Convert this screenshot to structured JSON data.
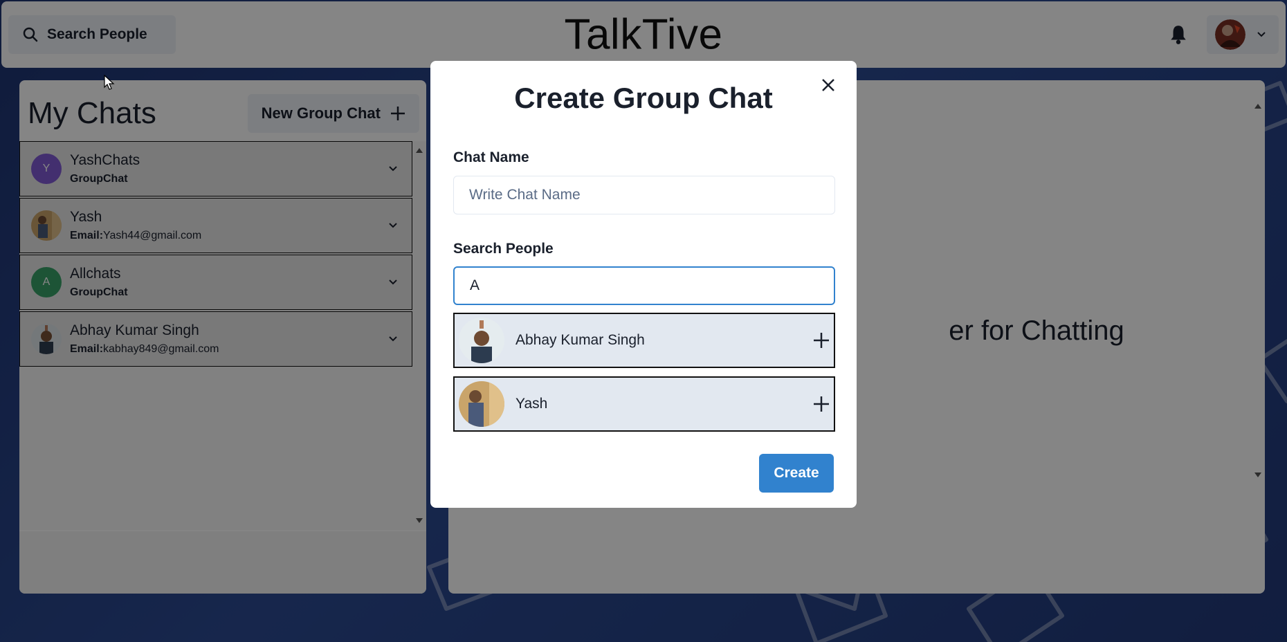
{
  "header": {
    "search_label": "Search People",
    "app_title": "TalkTive"
  },
  "chats": {
    "title": "My Chats",
    "new_group_label": "New Group Chat",
    "items": [
      {
        "name": "YashChats",
        "sub_label": "",
        "sub_value": "GroupChat",
        "avatar_letter": "Y",
        "avatar_color": "#805ad5"
      },
      {
        "name": "Yash",
        "sub_label": "Email:",
        "sub_value": "Yash44@gmail.com",
        "avatar_letter": "",
        "avatar_color": "#c9a46a"
      },
      {
        "name": "Allchats",
        "sub_label": "",
        "sub_value": "GroupChat",
        "avatar_letter": "A",
        "avatar_color": "#38a169"
      },
      {
        "name": "Abhay Kumar Singh",
        "sub_label": "Email:",
        "sub_value": "kabhay849@gmail.com",
        "avatar_letter": "",
        "avatar_color": "#dfe6ea"
      }
    ]
  },
  "chat_area": {
    "placeholder_visible": "er for Chatting"
  },
  "modal": {
    "title": "Create Group Chat",
    "chat_name_label": "Chat Name",
    "chat_name_placeholder": "Write Chat Name",
    "chat_name_value": "",
    "search_label": "Search People",
    "search_value": "A",
    "results": [
      {
        "name": "Abhay Kumar Singh"
      },
      {
        "name": "Yash"
      }
    ],
    "create_label": "Create"
  },
  "colors": {
    "primary": "#3182ce",
    "background": "#233a78"
  }
}
